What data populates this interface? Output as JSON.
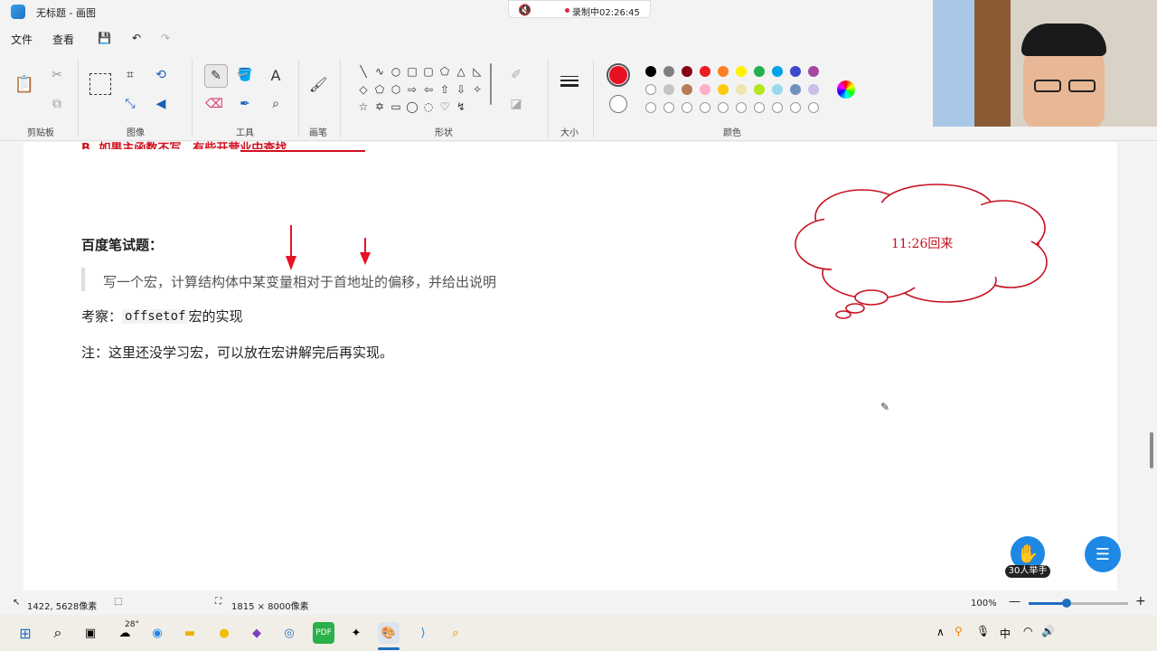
{
  "window": {
    "title": "无标题 - 画图"
  },
  "recording": {
    "status": "录制中02:26:45"
  },
  "menu": {
    "file": "文件",
    "view": "查看"
  },
  "ribbon": {
    "groups": {
      "clipboard": "剪贴板",
      "image": "图像",
      "tools": "工具",
      "brushes": "画笔",
      "shapes": "形状",
      "size": "大小",
      "colors": "颜色"
    },
    "primary_color": "#e81123",
    "secondary_color": "#ffffff",
    "palette_row1": [
      "#000000",
      "#7f7f7f",
      "#880015",
      "#ed1c24",
      "#ff7f27",
      "#fff200",
      "#22b14c",
      "#00a2e8",
      "#3f48cc",
      "#a349a4"
    ],
    "palette_row2": [
      "#ffffff",
      "#c3c3c3",
      "#b97a57",
      "#ffaec9",
      "#ffc90e",
      "#efe4b0",
      "#b5e61d",
      "#99d9ea",
      "#7092be",
      "#c8bfe7"
    ]
  },
  "canvas": {
    "partial_heading": "B. 如果主函数不写，有些开营业中查找",
    "section_title": "百度笔试题：",
    "quote": "写一个宏，计算结构体中某变量相对于首地址的偏移，并给出说明",
    "inspect_label": "考察：",
    "inspect_code": "offsetof",
    "inspect_rest": "宏的实现",
    "note": "注：这里还没学习宏，可以放在宏讲解完后再实现。",
    "cloud_text": "11:26回来"
  },
  "overlay": {
    "raise_hand": "30人举手"
  },
  "status": {
    "cursor_pos": "1422, 5628像素",
    "canvas_size": "1815 × 8000像素",
    "zoom": "100%"
  },
  "taskbar": {
    "weather": "28°",
    "ime": "中"
  }
}
